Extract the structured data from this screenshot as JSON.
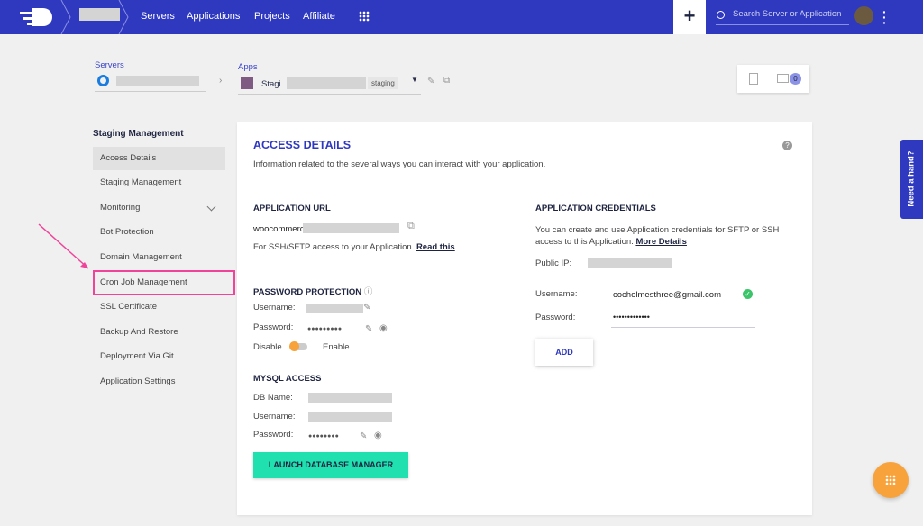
{
  "topbar": {
    "nav": [
      "Servers",
      "Applications",
      "Projects",
      "Affiliate"
    ],
    "plus": "+",
    "search_placeholder": "Search Server or Application"
  },
  "breadcrumb": {
    "servers_label": "Servers",
    "apps_label": "Apps",
    "app_name": "Stagi",
    "app_tag": "staging",
    "notif_count": "0"
  },
  "sidebar": {
    "title": "Staging Management",
    "items": [
      "Access Details",
      "Staging Management",
      "Monitoring",
      "Bot Protection",
      "Domain Management",
      "Cron Job Management",
      "SSL Certificate",
      "Backup And Restore",
      "Deployment Via Git",
      "Application Settings"
    ]
  },
  "main": {
    "title": "ACCESS DETAILS",
    "subtitle": "Information related to the several ways you can interact with your application.",
    "app_url": {
      "heading": "APPLICATION URL",
      "url": "woocommerce-",
      "note": "For SSH/SFTP access to your Application.",
      "link": "Read this"
    },
    "pw": {
      "heading": "PASSWORD PROTECTION",
      "username": "Username:",
      "password": "Password:",
      "dots": "●●●●●●●●●",
      "disable": "Disable",
      "enable": "Enable"
    },
    "mysql": {
      "heading": "MYSQL ACCESS",
      "db": "DB Name:",
      "username": "Username:",
      "password": "Password:",
      "dots": "●●●●●●●●",
      "button": "LAUNCH DATABASE MANAGER"
    },
    "creds": {
      "heading": "APPLICATION CREDENTIALS",
      "desc": "You can create and use Application credentials for SFTP or SSH access to this Application.",
      "link": "More Details",
      "ip": "Public IP:",
      "username": "Username:",
      "username_value": "cocholmesthree@gmail.com",
      "password": "Password:",
      "password_value": "•••••••••••••",
      "add": "ADD"
    }
  },
  "help_tab": "Need a hand?"
}
